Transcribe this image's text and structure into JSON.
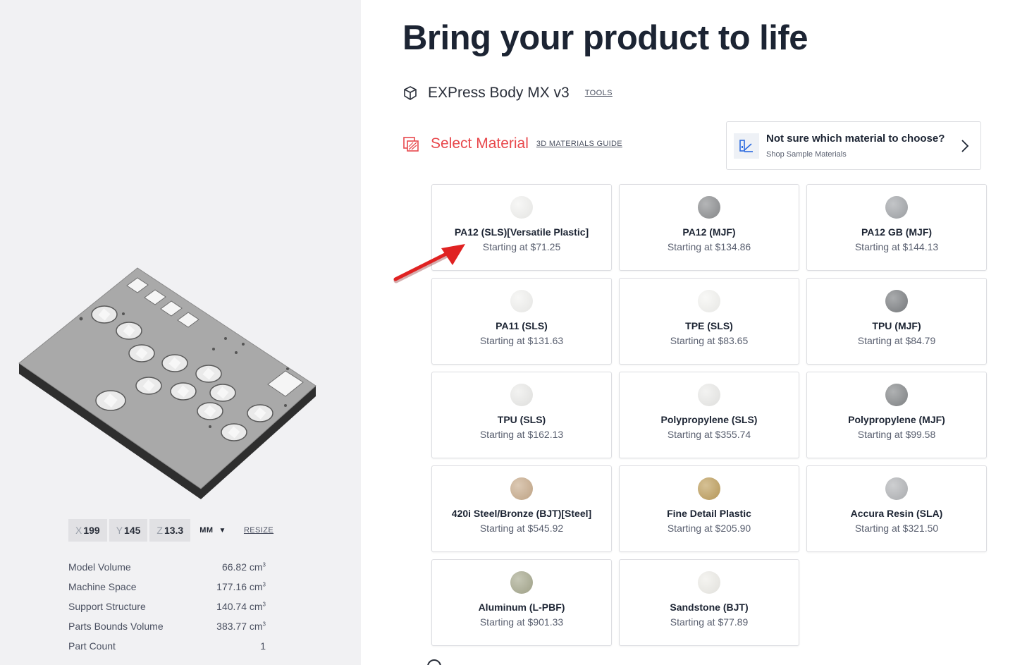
{
  "headline": "Bring your product to life",
  "part": {
    "icon": "cube-icon",
    "name": "EXPress Body MX v3",
    "tools_label": "TOOLS"
  },
  "select_material": {
    "icon": "material-icon",
    "title": "Select Material",
    "guide_label": "3D MATERIALS GUIDE"
  },
  "help_card": {
    "icon": "sample-materials-icon",
    "question": "Not sure which material to choose?",
    "subtitle": "Shop Sample Materials"
  },
  "materials": [
    {
      "name": "PA12 (SLS)[Versatile Plastic]",
      "price": "Starting at $71.25",
      "color": "#f3f3f1"
    },
    {
      "name": "PA12 (MJF)",
      "price": "Starting at $134.86",
      "color": "#8c8e90"
    },
    {
      "name": "PA12 GB (MJF)",
      "price": "Starting at $144.13",
      "color": "#a3a6aa"
    },
    {
      "name": "PA11 (SLS)",
      "price": "Starting at $131.63",
      "color": "#f3f3f1"
    },
    {
      "name": "TPE (SLS)",
      "price": "Starting at $83.65",
      "color": "#f5f5f2"
    },
    {
      "name": "TPU (MJF)",
      "price": "Starting at $84.79",
      "color": "#7c7f82"
    },
    {
      "name": "TPU (SLS)",
      "price": "Starting at $162.13",
      "color": "#ececea"
    },
    {
      "name": "Polypropylene (SLS)",
      "price": "Starting at $355.74",
      "color": "#ececea"
    },
    {
      "name": "Polypropylene (MJF)",
      "price": "Starting at $99.58",
      "color": "#85888a"
    },
    {
      "name": "420i Steel/Bronze (BJT)[Steel]",
      "price": "Starting at $545.92",
      "color": "#c9ac8c"
    },
    {
      "name": "Fine Detail Plastic",
      "price": "Starting at $205.90",
      "color": "#bf9f5c"
    },
    {
      "name": "Accura Resin (SLA)",
      "price": "Starting at $321.50",
      "color": "#b3b5b8"
    },
    {
      "name": "Aluminum (L-PBF)",
      "price": "Starting at $901.33",
      "color": "#a7a98e"
    },
    {
      "name": "Sandstone (BJT)",
      "price": "Starting at $77.89",
      "color": "#efeee9"
    }
  ],
  "dimensions": {
    "x_label": "X",
    "x": "199",
    "y_label": "Y",
    "y": "145",
    "z_label": "Z",
    "z": "13.3",
    "unit": "MM",
    "resize_label": "RESIZE"
  },
  "stats": [
    {
      "label": "Model Volume",
      "value": "66.82 cm",
      "sup": "3"
    },
    {
      "label": "Machine Space",
      "value": "177.16 cm",
      "sup": "3"
    },
    {
      "label": "Support Structure",
      "value": "140.74 cm",
      "sup": "3"
    },
    {
      "label": "Parts Bounds Volume",
      "value": "383.77 cm",
      "sup": "3"
    },
    {
      "label": "Part Count",
      "value": "1",
      "sup": ""
    }
  ],
  "colors": {
    "accent_red": "#e8484c",
    "headline": "#1c2433",
    "panel_bg": "#f1f1f3"
  }
}
